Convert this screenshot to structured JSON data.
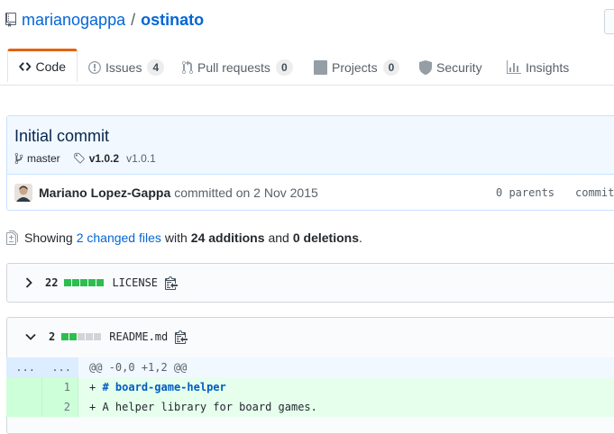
{
  "repo": {
    "owner": "marianogappa",
    "separator": "/",
    "name": "ostinato"
  },
  "tabs": [
    {
      "label": "Code",
      "icon": "code-icon"
    },
    {
      "label": "Issues",
      "count": "4",
      "icon": "issue-icon"
    },
    {
      "label": "Pull requests",
      "count": "0",
      "icon": "pull-request-icon"
    },
    {
      "label": "Projects",
      "count": "0",
      "icon": "project-icon"
    },
    {
      "label": "Security",
      "icon": "shield-icon"
    },
    {
      "label": "Insights",
      "icon": "graph-icon"
    }
  ],
  "commit": {
    "title": "Initial commit",
    "branch": "master",
    "tag_primary": "v1.0.2",
    "tag_secondary": "v1.0.1",
    "author": "Mariano Lopez-Gappa",
    "committed": "committed on 2 Nov 2015",
    "parents": "0 parents",
    "commit_label": "commit"
  },
  "toc": {
    "showing": "Showing",
    "changed_files": "2 changed files",
    "with": "with",
    "additions": "24 additions",
    "and": "and",
    "deletions": "0 deletions",
    "period": "."
  },
  "files": [
    {
      "changes": "22",
      "name": "LICENSE",
      "expanded": false,
      "blocks": [
        "added",
        "added",
        "added",
        "added",
        "added"
      ]
    },
    {
      "changes": "2",
      "name": "README.md",
      "expanded": true,
      "blocks": [
        "added",
        "added",
        "neutral",
        "neutral",
        "neutral"
      ]
    }
  ],
  "diff": {
    "hunk": {
      "old_ln": "...",
      "new_ln": "...",
      "text": "@@ -0,0 +1,2 @@"
    },
    "lines": [
      {
        "new_ln": "1",
        "sign": "+",
        "text": "# board-game-helper"
      },
      {
        "new_ln": "2",
        "sign": "+",
        "text": "A helper library for board games."
      }
    ]
  },
  "colors": {
    "link": "#0366d6",
    "added": "#2cbe4e",
    "active_tab": "#e36209"
  }
}
